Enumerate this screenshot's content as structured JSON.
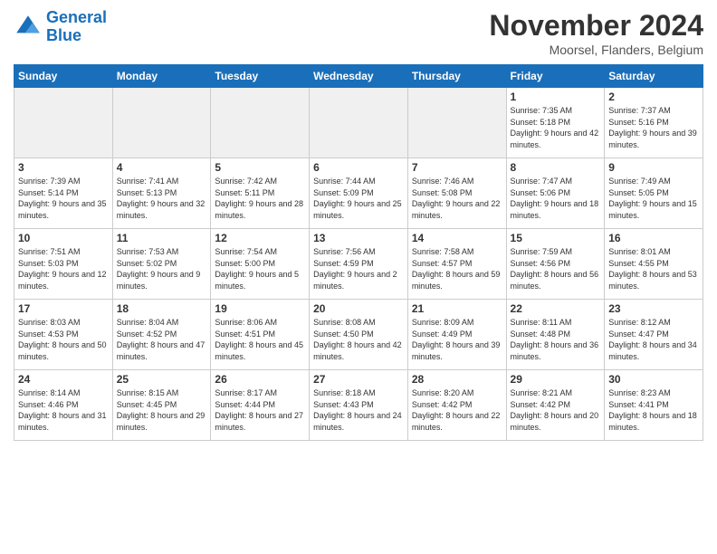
{
  "header": {
    "logo_line1": "General",
    "logo_line2": "Blue",
    "month": "November 2024",
    "location": "Moorsel, Flanders, Belgium"
  },
  "days_of_week": [
    "Sunday",
    "Monday",
    "Tuesday",
    "Wednesday",
    "Thursday",
    "Friday",
    "Saturday"
  ],
  "weeks": [
    [
      {
        "day": "",
        "info": ""
      },
      {
        "day": "",
        "info": ""
      },
      {
        "day": "",
        "info": ""
      },
      {
        "day": "",
        "info": ""
      },
      {
        "day": "",
        "info": ""
      },
      {
        "day": "1",
        "info": "Sunrise: 7:35 AM\nSunset: 5:18 PM\nDaylight: 9 hours and 42 minutes."
      },
      {
        "day": "2",
        "info": "Sunrise: 7:37 AM\nSunset: 5:16 PM\nDaylight: 9 hours and 39 minutes."
      }
    ],
    [
      {
        "day": "3",
        "info": "Sunrise: 7:39 AM\nSunset: 5:14 PM\nDaylight: 9 hours and 35 minutes."
      },
      {
        "day": "4",
        "info": "Sunrise: 7:41 AM\nSunset: 5:13 PM\nDaylight: 9 hours and 32 minutes."
      },
      {
        "day": "5",
        "info": "Sunrise: 7:42 AM\nSunset: 5:11 PM\nDaylight: 9 hours and 28 minutes."
      },
      {
        "day": "6",
        "info": "Sunrise: 7:44 AM\nSunset: 5:09 PM\nDaylight: 9 hours and 25 minutes."
      },
      {
        "day": "7",
        "info": "Sunrise: 7:46 AM\nSunset: 5:08 PM\nDaylight: 9 hours and 22 minutes."
      },
      {
        "day": "8",
        "info": "Sunrise: 7:47 AM\nSunset: 5:06 PM\nDaylight: 9 hours and 18 minutes."
      },
      {
        "day": "9",
        "info": "Sunrise: 7:49 AM\nSunset: 5:05 PM\nDaylight: 9 hours and 15 minutes."
      }
    ],
    [
      {
        "day": "10",
        "info": "Sunrise: 7:51 AM\nSunset: 5:03 PM\nDaylight: 9 hours and 12 minutes."
      },
      {
        "day": "11",
        "info": "Sunrise: 7:53 AM\nSunset: 5:02 PM\nDaylight: 9 hours and 9 minutes."
      },
      {
        "day": "12",
        "info": "Sunrise: 7:54 AM\nSunset: 5:00 PM\nDaylight: 9 hours and 5 minutes."
      },
      {
        "day": "13",
        "info": "Sunrise: 7:56 AM\nSunset: 4:59 PM\nDaylight: 9 hours and 2 minutes."
      },
      {
        "day": "14",
        "info": "Sunrise: 7:58 AM\nSunset: 4:57 PM\nDaylight: 8 hours and 59 minutes."
      },
      {
        "day": "15",
        "info": "Sunrise: 7:59 AM\nSunset: 4:56 PM\nDaylight: 8 hours and 56 minutes."
      },
      {
        "day": "16",
        "info": "Sunrise: 8:01 AM\nSunset: 4:55 PM\nDaylight: 8 hours and 53 minutes."
      }
    ],
    [
      {
        "day": "17",
        "info": "Sunrise: 8:03 AM\nSunset: 4:53 PM\nDaylight: 8 hours and 50 minutes."
      },
      {
        "day": "18",
        "info": "Sunrise: 8:04 AM\nSunset: 4:52 PM\nDaylight: 8 hours and 47 minutes."
      },
      {
        "day": "19",
        "info": "Sunrise: 8:06 AM\nSunset: 4:51 PM\nDaylight: 8 hours and 45 minutes."
      },
      {
        "day": "20",
        "info": "Sunrise: 8:08 AM\nSunset: 4:50 PM\nDaylight: 8 hours and 42 minutes."
      },
      {
        "day": "21",
        "info": "Sunrise: 8:09 AM\nSunset: 4:49 PM\nDaylight: 8 hours and 39 minutes."
      },
      {
        "day": "22",
        "info": "Sunrise: 8:11 AM\nSunset: 4:48 PM\nDaylight: 8 hours and 36 minutes."
      },
      {
        "day": "23",
        "info": "Sunrise: 8:12 AM\nSunset: 4:47 PM\nDaylight: 8 hours and 34 minutes."
      }
    ],
    [
      {
        "day": "24",
        "info": "Sunrise: 8:14 AM\nSunset: 4:46 PM\nDaylight: 8 hours and 31 minutes."
      },
      {
        "day": "25",
        "info": "Sunrise: 8:15 AM\nSunset: 4:45 PM\nDaylight: 8 hours and 29 minutes."
      },
      {
        "day": "26",
        "info": "Sunrise: 8:17 AM\nSunset: 4:44 PM\nDaylight: 8 hours and 27 minutes."
      },
      {
        "day": "27",
        "info": "Sunrise: 8:18 AM\nSunset: 4:43 PM\nDaylight: 8 hours and 24 minutes."
      },
      {
        "day": "28",
        "info": "Sunrise: 8:20 AM\nSunset: 4:42 PM\nDaylight: 8 hours and 22 minutes."
      },
      {
        "day": "29",
        "info": "Sunrise: 8:21 AM\nSunset: 4:42 PM\nDaylight: 8 hours and 20 minutes."
      },
      {
        "day": "30",
        "info": "Sunrise: 8:23 AM\nSunset: 4:41 PM\nDaylight: 8 hours and 18 minutes."
      }
    ]
  ]
}
